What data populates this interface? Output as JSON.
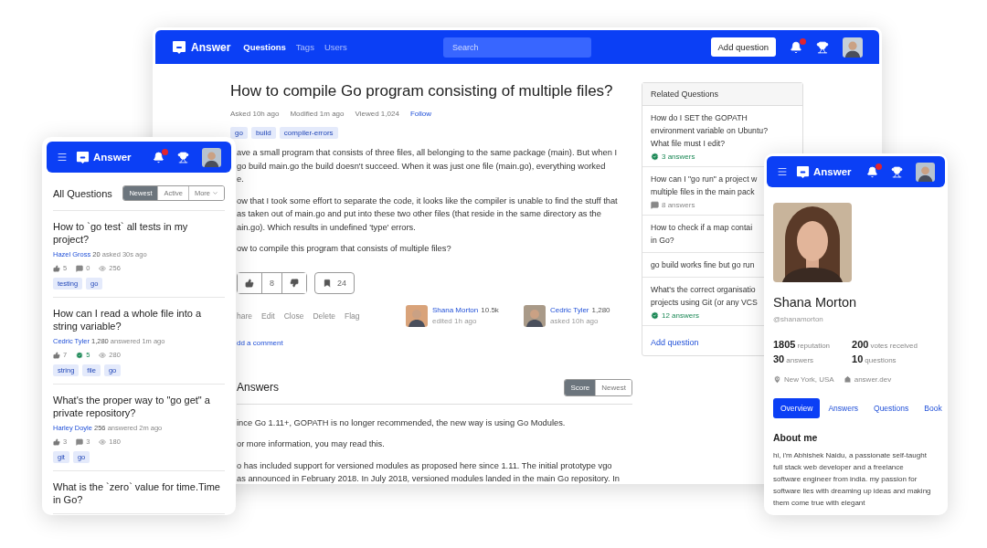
{
  "main_window": {
    "header": {
      "logo": "Answer",
      "nav": [
        {
          "label": "Questions",
          "selected": true
        },
        {
          "label": "Tags",
          "selected": false
        },
        {
          "label": "Users",
          "selected": false
        }
      ],
      "search": {
        "placeholder": "Search"
      },
      "add_button": "Add question",
      "notifications_unread": true
    },
    "question": {
      "title": "How to compile Go program consisting of multiple files?",
      "meta": [
        "Asked 10h ago",
        "Modified 1m ago",
        "Viewed 1,024"
      ],
      "follow": "Follow",
      "tags": [
        "go",
        "build",
        "compiler-errors"
      ],
      "body": [
        [
          "ave a small program that consists of three files, all belonging to the same package (main). But when I",
          "go build main.go the build doesn't succeed. When it was just one file (main.go), everything worked",
          "e."
        ],
        [
          "ow that I took some effort to separate the code, it looks like the compiler is unable to find the stuff that",
          "as taken out of main.go and put into these two other files (that reside in the same directory as the",
          "ain.go). Which results in undefined 'type' errors."
        ],
        [
          "ow to compile this program that consists of multiple files?"
        ]
      ],
      "votes": "8",
      "bookmarks": "24",
      "actions": [
        "hare",
        "Edit",
        "Close",
        "Delete",
        "Flag"
      ],
      "users": [
        {
          "name": "Shana Morton",
          "reputation": "10.5k",
          "time": "edited 1h ago"
        },
        {
          "name": "Cedric Tyler",
          "reputation": "1,280",
          "time": "asked 10h ago"
        }
      ],
      "add_comment": "dd a comment"
    },
    "answers": {
      "heading": "Answers",
      "sort": [
        {
          "label": "Score",
          "selected": true
        },
        {
          "label": "Newest",
          "selected": false
        }
      ],
      "body": [
        [
          "ince Go 1.11+, GOPATH is no longer recommended, the new way is using Go Modules."
        ],
        [
          "or more information, you may read this."
        ],
        [
          "o has included support for versioned modules as proposed here since 1.11. The initial prototype vgo",
          "as announced in February 2018. In July 2018, versioned modules landed in the main Go repository. In"
        ]
      ]
    },
    "related": {
      "title": "Related Questions",
      "items": [
        {
          "lines": [
            "How do I SET the GOPATH",
            "environment variable on Ubuntu?",
            "What file must I edit?"
          ],
          "answers": "3 answers",
          "accepted": true
        },
        {
          "lines": [
            "How can I \"go run\" a project w",
            "multiple files in the main pack"
          ],
          "answers": "8 answers",
          "accepted": false
        },
        {
          "lines": [
            "How to check if a map contai",
            "in Go?"
          ]
        },
        {
          "lines": [
            "go build works fine but go run"
          ]
        },
        {
          "lines": [
            "What's the correct organisatio",
            "projects using Git (or any VCS"
          ],
          "answers": "12 answers",
          "accepted": true
        }
      ],
      "add_link": "Add question"
    }
  },
  "questions_phone": {
    "header": {
      "logo": "Answer",
      "notifications_unread": true
    },
    "title": "All Questions",
    "sort": [
      {
        "label": "Newest",
        "selected": true
      },
      {
        "label": "Active",
        "selected": false
      },
      {
        "label": "More",
        "selected": false
      }
    ],
    "questions": [
      {
        "title": "How to `go test` all tests in my project?",
        "author": "Hazel Gross",
        "reputation": "20",
        "time": "asked 30s ago",
        "votes": "5",
        "answers": "0",
        "accepted": false,
        "views": "256",
        "tags": [
          "testing",
          "go"
        ]
      },
      {
        "title": "How can I read a whole file into a string variable?",
        "author": "Cedric Tyler",
        "reputation": "1,280",
        "time": "answered 1m ago",
        "votes": "7",
        "answers": "5",
        "accepted": true,
        "views": "280",
        "tags": [
          "string",
          "file",
          "go"
        ]
      },
      {
        "title": "What's the proper way to \"go get\" a private repository?",
        "author": "Harley Doyle",
        "reputation": "256",
        "time": "answered 2m ago",
        "votes": "3",
        "answers": "3",
        "accepted": false,
        "views": "180",
        "tags": [
          "git",
          "go"
        ]
      },
      {
        "title": "What is the `zero` value for time.Time in Go?"
      }
    ]
  },
  "profile_phone": {
    "header": {
      "logo": "Answer",
      "notifications_unread": true
    },
    "name": "Shana Morton",
    "handle": "@shanamorton",
    "stats": [
      {
        "value": "1805",
        "label": "reputation"
      },
      {
        "value": "200",
        "label": "votes received"
      },
      {
        "value": "30",
        "label": "answers"
      },
      {
        "value": "10",
        "label": "questions"
      }
    ],
    "location": "New York, USA",
    "website": "answer.dev",
    "tabs": [
      {
        "label": "Overview",
        "selected": true
      },
      {
        "label": "Answers",
        "selected": false
      },
      {
        "label": "Questions",
        "selected": false
      },
      {
        "label": "Book",
        "selected": false
      }
    ],
    "about_heading": "About me",
    "about": "hi, i'm Abhishek Naidu, a passionate self-taught full stack web developer and a freelance software engineer from india. my passion for software lies with dreaming up ideas and making them come true with elegant"
  }
}
